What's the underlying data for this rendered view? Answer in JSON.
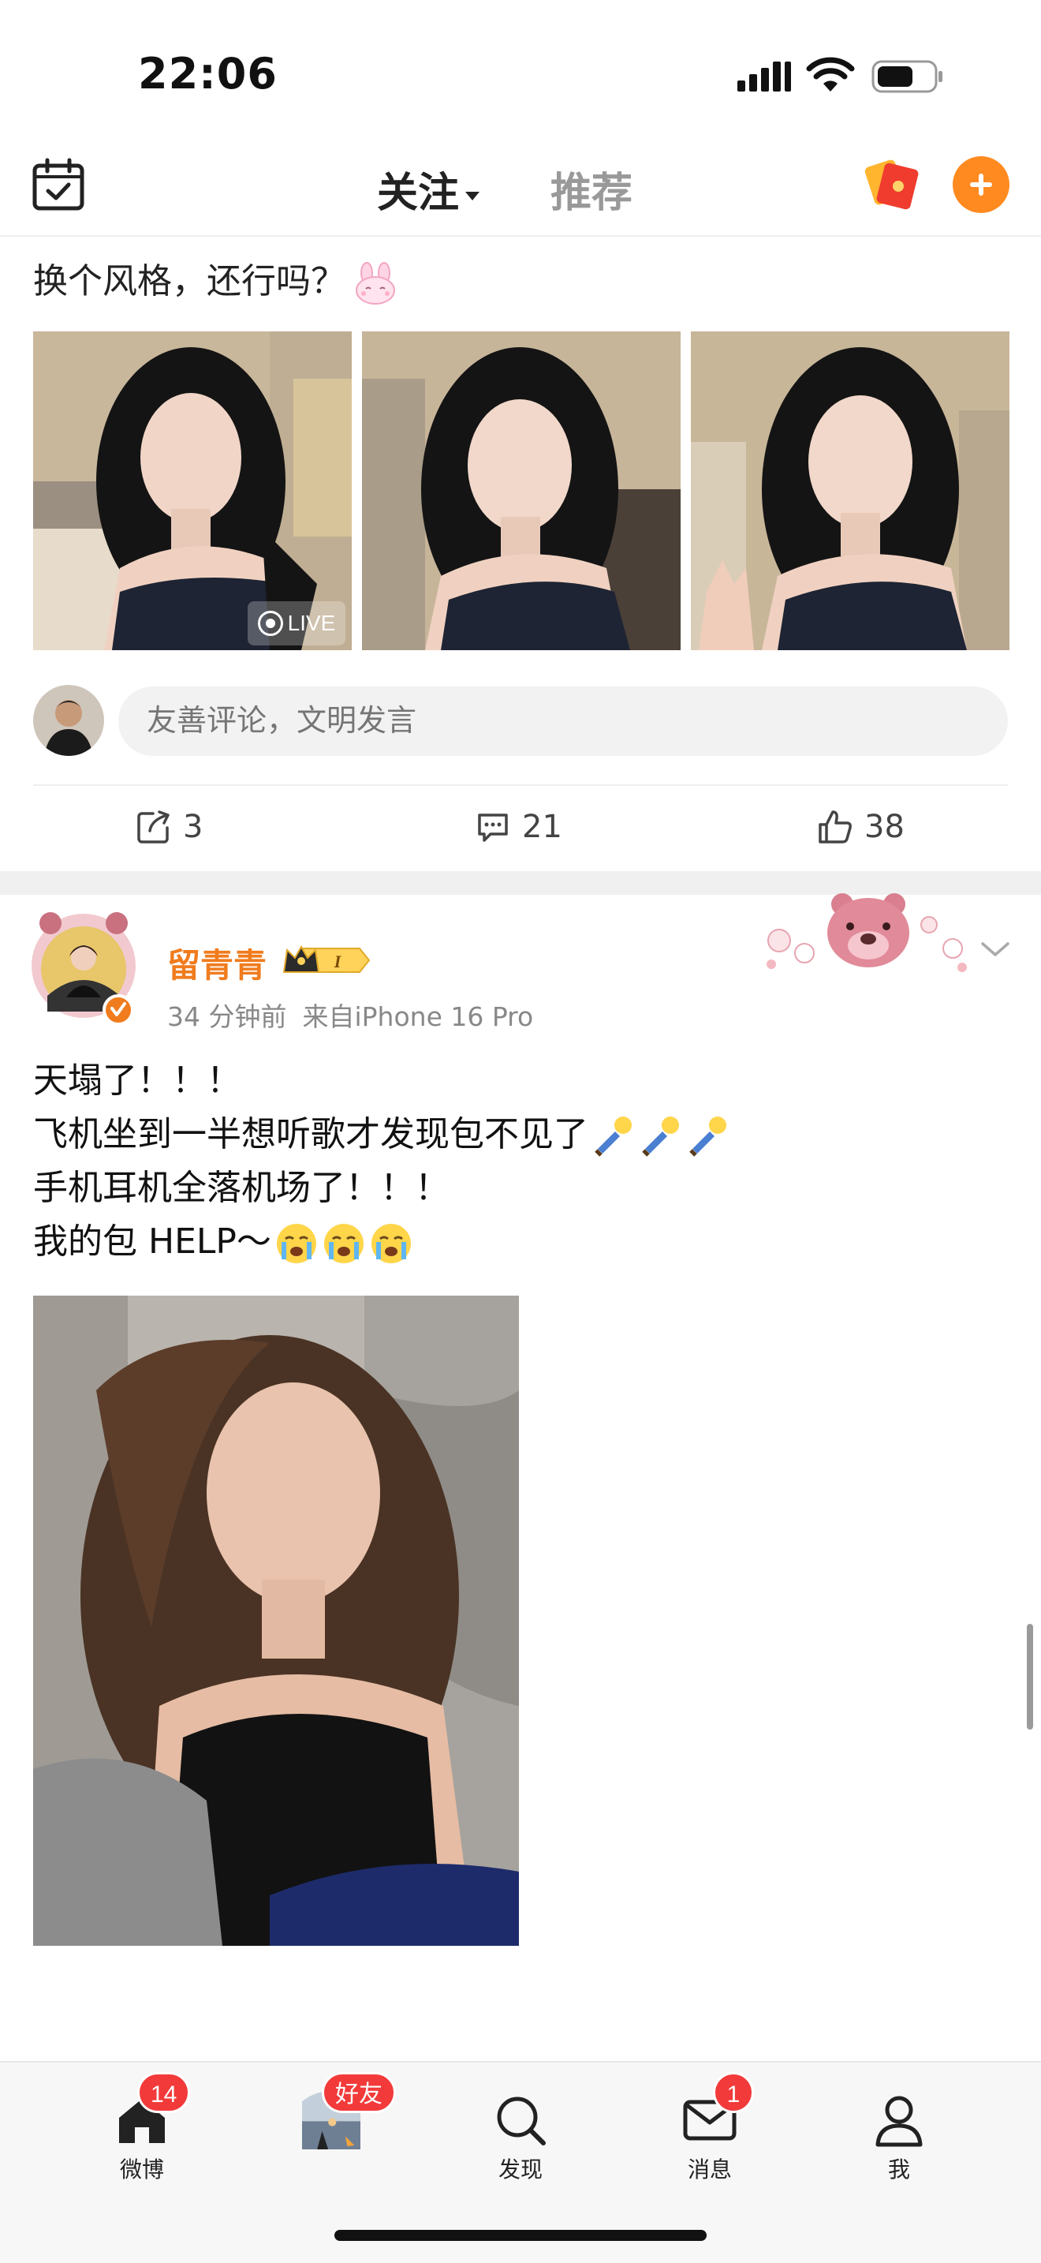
{
  "status_bar": {
    "time": "22:06"
  },
  "top_nav": {
    "tabs": [
      {
        "label": "关注",
        "active": true
      },
      {
        "label": "推荐",
        "active": false
      }
    ]
  },
  "post1": {
    "text": "换个风格，还行吗？",
    "photos": [
      {
        "live_label": "LIVE"
      }
    ],
    "comment_placeholder": "友善评论，文明发言",
    "actions": {
      "repost_count": "3",
      "comment_count": "21",
      "like_count": "38"
    }
  },
  "post2": {
    "author": "留青青",
    "vip_level": "I",
    "time": "34 分钟前",
    "source": "来自iPhone 16 Pro",
    "lines": [
      "天塌了！！！",
      "飞机坐到一半想听歌才发现包不见了",
      "手机耳机全落机场了！！！",
      "我的包  HELP～"
    ]
  },
  "tabbar": {
    "items": [
      {
        "label": "微博",
        "badge": "14"
      },
      {
        "label": "",
        "badge": "好友"
      },
      {
        "label": "发现",
        "badge": ""
      },
      {
        "label": "消息",
        "badge": "1"
      },
      {
        "label": "我",
        "badge": ""
      }
    ]
  },
  "colors": {
    "accent": "#ff8a1f",
    "username": "#f07c1e",
    "badge_red": "#f23a3a"
  }
}
